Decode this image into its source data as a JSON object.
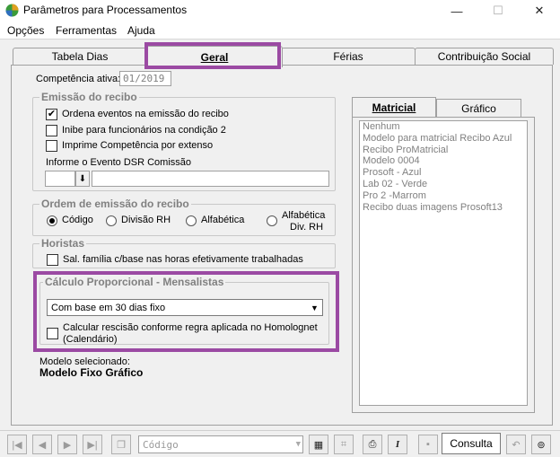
{
  "window": {
    "title": "Parâmetros para Processamentos",
    "minimize": "—",
    "maximize": "☐",
    "close": "✕"
  },
  "menu": [
    {
      "label": "Opções"
    },
    {
      "label": "Ferramentas"
    },
    {
      "label": "Ajuda"
    }
  ],
  "tabs": [
    {
      "label": "Tabela Dias"
    },
    {
      "label": "Geral"
    },
    {
      "label": "Férias"
    },
    {
      "label": "Contribuição Social"
    }
  ],
  "competencia": {
    "label": "Competência ativa:",
    "value": "01/2019"
  },
  "emissao": {
    "legend": "Emissão do recibo",
    "ordena": {
      "label": "Ordena eventos na emissão do recibo",
      "checked": true
    },
    "inibe": {
      "label": "Inibe para funcionários na condição 2",
      "checked": false
    },
    "imprime": {
      "label": "Imprime Competência por extenso",
      "checked": false
    },
    "dsr_label": "Informe o Evento DSR Comissão",
    "dsr_button": "⬇"
  },
  "ordem": {
    "legend": "Ordem de emissão do recibo",
    "options": [
      {
        "label": "Código",
        "selected": true
      },
      {
        "label": "Divisão RH",
        "selected": false
      },
      {
        "label": "Alfabética",
        "selected": false
      },
      {
        "label": "Alfabética\nDiv. RH",
        "selected": false
      }
    ],
    "opt4_line1": "Alfabética",
    "opt4_line2": "Div. RH"
  },
  "horistas": {
    "legend": "Horistas",
    "salfamilia": {
      "label": "Sal. família c/base nas horas efetivamente trabalhadas",
      "checked": false
    }
  },
  "calculo": {
    "legend": "Cálculo Proporcional - Mensalistas",
    "select_value": "Com base em 30 dias fixo",
    "rescisao_line1": "Calcular rescisão conforme regra aplicada no Homolognet",
    "rescisao_line2": "(Calendário)",
    "rescisao_checked": false
  },
  "modelo": {
    "label": "Modelo selecionado:",
    "value": "Modelo Fixo Gráfico"
  },
  "right_tabs": [
    {
      "label": "Matricial"
    },
    {
      "label": "Gráfico"
    }
  ],
  "right_list": [
    "Nenhum",
    "Modelo para matricial Recibo Azul",
    "Recibo ProMatricial",
    "Modelo 0004",
    "Prosoft - Azul",
    "Lab 02 - Verde",
    "Pro 2 -Marrom",
    "Recibo duas imagens Prosoft13"
  ],
  "toolbar": {
    "search_placeholder": "Código",
    "consulta": "Consulta"
  },
  "colors": {
    "highlight": "#9b4aa3",
    "disabled_text": "#808080"
  }
}
